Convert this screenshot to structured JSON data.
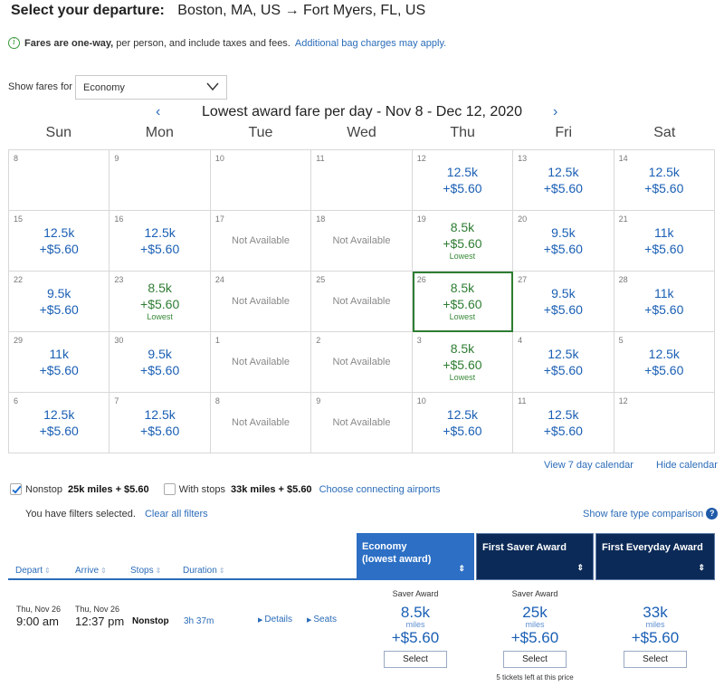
{
  "header": {
    "label": "Select your departure:",
    "origin": "Boston, MA, US",
    "arrow": "→",
    "destination": "Fort Myers, FL, US"
  },
  "info": {
    "icon": "info-circle-icon",
    "bold": "Fares are one-way,",
    "text": "per person, and include taxes and fees.",
    "link": "Additional bag charges may apply."
  },
  "fare_filter": {
    "label": "Show fares for",
    "selected": "Economy"
  },
  "calendar": {
    "prev": "‹",
    "next": "›",
    "title": "Lowest award fare per day - Nov 8 - Dec 12, 2020",
    "weekdays": [
      "Sun",
      "Mon",
      "Tue",
      "Wed",
      "Thu",
      "Fri",
      "Sat"
    ],
    "lowest_label": "Lowest",
    "not_available": "Not Available",
    "selected_date": "26",
    "days": [
      {
        "day": "8",
        "status": "empty"
      },
      {
        "day": "9",
        "status": "empty"
      },
      {
        "day": "10",
        "status": "empty"
      },
      {
        "day": "11",
        "status": "empty"
      },
      {
        "day": "12",
        "status": "fare",
        "miles": "12.5k",
        "tax": "+$5.60"
      },
      {
        "day": "13",
        "status": "fare",
        "miles": "12.5k",
        "tax": "+$5.60"
      },
      {
        "day": "14",
        "status": "fare",
        "miles": "12.5k",
        "tax": "+$5.60"
      },
      {
        "day": "15",
        "status": "fare",
        "miles": "12.5k",
        "tax": "+$5.60"
      },
      {
        "day": "16",
        "status": "fare",
        "miles": "12.5k",
        "tax": "+$5.60"
      },
      {
        "day": "17",
        "status": "na"
      },
      {
        "day": "18",
        "status": "na"
      },
      {
        "day": "19",
        "status": "lowest",
        "miles": "8.5k",
        "tax": "+$5.60"
      },
      {
        "day": "20",
        "status": "fare",
        "miles": "9.5k",
        "tax": "+$5.60"
      },
      {
        "day": "21",
        "status": "fare",
        "miles": "11k",
        "tax": "+$5.60"
      },
      {
        "day": "22",
        "status": "fare",
        "miles": "9.5k",
        "tax": "+$5.60"
      },
      {
        "day": "23",
        "status": "lowest",
        "miles": "8.5k",
        "tax": "+$5.60"
      },
      {
        "day": "24",
        "status": "na"
      },
      {
        "day": "25",
        "status": "na"
      },
      {
        "day": "26",
        "status": "lowest",
        "miles": "8.5k",
        "tax": "+$5.60"
      },
      {
        "day": "27",
        "status": "fare",
        "miles": "9.5k",
        "tax": "+$5.60"
      },
      {
        "day": "28",
        "status": "fare",
        "miles": "11k",
        "tax": "+$5.60"
      },
      {
        "day": "29",
        "status": "fare",
        "miles": "11k",
        "tax": "+$5.60"
      },
      {
        "day": "30",
        "status": "fare",
        "miles": "9.5k",
        "tax": "+$5.60"
      },
      {
        "day": "1",
        "status": "na"
      },
      {
        "day": "2",
        "status": "na"
      },
      {
        "day": "3",
        "status": "lowest",
        "miles": "8.5k",
        "tax": "+$5.60"
      },
      {
        "day": "4",
        "status": "fare",
        "miles": "12.5k",
        "tax": "+$5.60"
      },
      {
        "day": "5",
        "status": "fare",
        "miles": "12.5k",
        "tax": "+$5.60"
      },
      {
        "day": "6",
        "status": "fare",
        "miles": "12.5k",
        "tax": "+$5.60"
      },
      {
        "day": "7",
        "status": "fare",
        "miles": "12.5k",
        "tax": "+$5.60"
      },
      {
        "day": "8",
        "status": "na"
      },
      {
        "day": "9",
        "status": "na"
      },
      {
        "day": "10",
        "status": "fare",
        "miles": "12.5k",
        "tax": "+$5.60"
      },
      {
        "day": "11",
        "status": "fare",
        "miles": "12.5k",
        "tax": "+$5.60"
      },
      {
        "day": "12",
        "status": "empty"
      }
    ],
    "view7_link": "View 7 day calendar",
    "hide_link": "Hide calendar"
  },
  "filters": {
    "nonstop": {
      "label": "Nonstop",
      "value": "25k miles + $5.60",
      "checked": true
    },
    "with_stops": {
      "label": "With stops",
      "value": "33k miles + $5.60",
      "checked": false
    },
    "connecting_link": "Choose connecting airports",
    "note": "You have filters selected.",
    "clear_link": "Clear all filters",
    "compare_link": "Show fare type comparison",
    "help_icon": "?"
  },
  "results": {
    "columns": [
      "Depart",
      "Arrive",
      "Stops",
      "Duration"
    ],
    "sort_icon": "⇕",
    "fare_headers": [
      {
        "line1": "Economy",
        "line2": "(lowest award)"
      },
      {
        "line1": "First Saver Award",
        "line2": ""
      },
      {
        "line1": "First Everyday Award",
        "line2": ""
      }
    ],
    "flight": {
      "depart_date": "Thu, Nov 26",
      "depart_time": "9:00 am",
      "arrive_date": "Thu, Nov 26",
      "arrive_time": "12:37 pm",
      "stops": "Nonstop",
      "duration": "3h 37m",
      "details_link": "Details",
      "seats_link": "Seats",
      "fares": [
        {
          "type": "Saver Award",
          "miles": "8.5k",
          "unit": "miles",
          "tax": "+$5.60",
          "button": "Select",
          "note": ""
        },
        {
          "type": "Saver Award",
          "miles": "25k",
          "unit": "miles",
          "tax": "+$5.60",
          "button": "Select",
          "note": "5 tickets left at this price"
        },
        {
          "type": "",
          "miles": "33k",
          "unit": "miles",
          "tax": "+$5.60",
          "button": "Select",
          "note": ""
        }
      ]
    }
  },
  "colors": {
    "link_blue": "#2b6cb8",
    "fare_blue": "#1a5fb4",
    "lowest_green": "#2e7d32",
    "economy_header": "#2c6fc4",
    "first_header": "#0b2a57"
  }
}
